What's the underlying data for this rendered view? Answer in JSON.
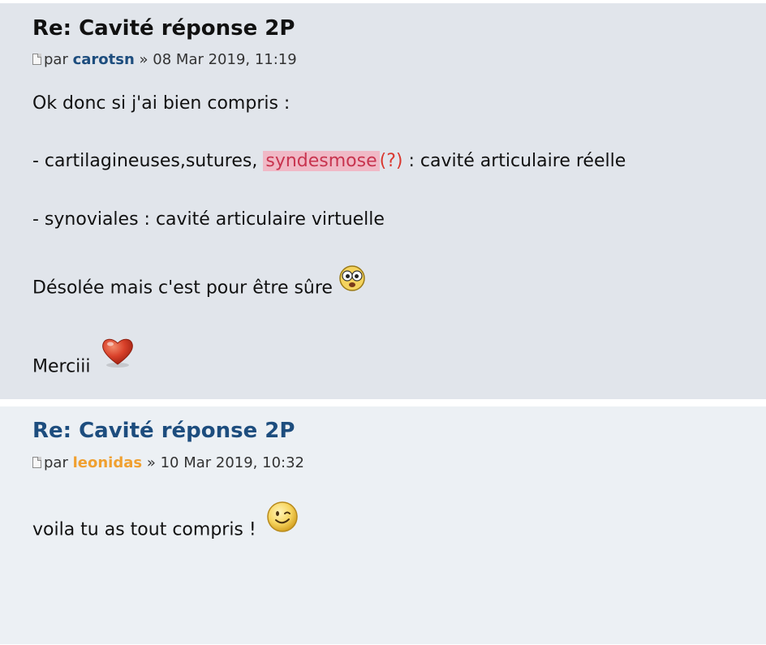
{
  "posts": [
    {
      "title": "Re: Cavité réponse 2P",
      "meta_prefix": "par",
      "author": "carotsn",
      "separator": "»",
      "date": "08 Mar 2019, 11:19",
      "lines": {
        "l1": "Ok donc si j'ai bien compris :",
        "l2_a": "- cartilagineuses,sutures, ",
        "l2_highlight": "syndesmose",
        "l2_q": "(?)",
        "l2_b": " : cavité articulaire réelle",
        "l3": "- synoviales : cavité articulaire virtuelle",
        "l4": "Désolée mais c'est pour être sûre",
        "l5": "Merciii"
      },
      "smileys": [
        "eek-icon",
        "heart-icon"
      ]
    },
    {
      "title": "Re: Cavité réponse 2P",
      "meta_prefix": "par",
      "author": "leonidas",
      "separator": "»",
      "date": "10 Mar 2019, 10:32",
      "lines": {
        "l1": "voila tu as tout compris !"
      },
      "smileys": [
        "wink-icon"
      ]
    }
  ],
  "colors": {
    "post1_bg": "#e1e5eb",
    "post2_bg": "#ecf0f4",
    "link_blue": "#1d4d7e",
    "author_orange": "#f0a030",
    "highlight_bg": "#f0b9c6"
  }
}
